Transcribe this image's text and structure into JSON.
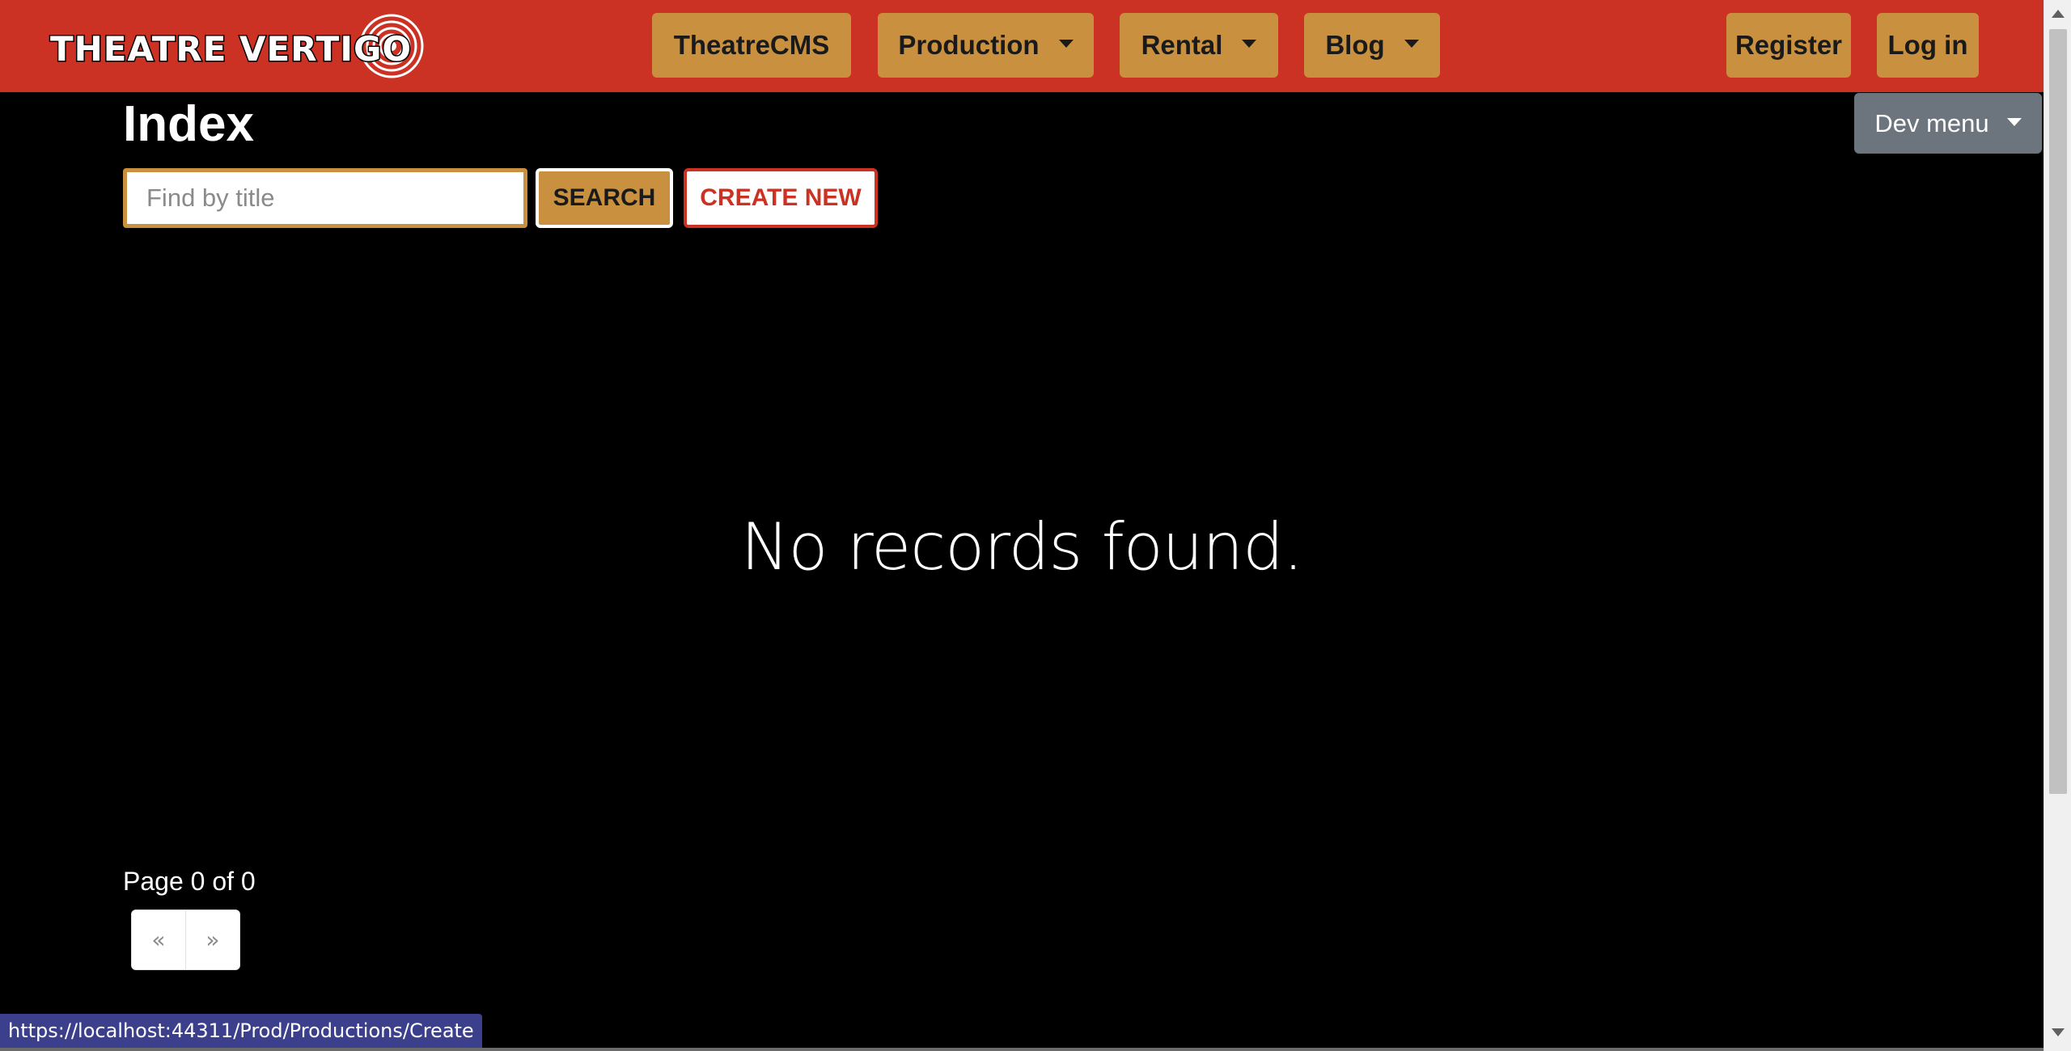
{
  "navbar": {
    "logo_text": "THEATRE VERTIGO",
    "items": [
      {
        "label": "TheatreCMS",
        "has_dropdown": false
      },
      {
        "label": "Production",
        "has_dropdown": true
      },
      {
        "label": "Rental",
        "has_dropdown": true
      },
      {
        "label": "Blog",
        "has_dropdown": true
      }
    ],
    "auth": {
      "register_label": "Register",
      "login_label": "Log in"
    },
    "colors": {
      "bar": "#cc3224",
      "button": "#c9913f"
    }
  },
  "dev_menu": {
    "label": "Dev menu"
  },
  "main": {
    "title": "Index",
    "search": {
      "placeholder": "Find by title",
      "value": "",
      "button_label": "SEARCH"
    },
    "create_label": "CREATE NEW",
    "empty_message": "No records found.",
    "pagination": {
      "summary": "Page 0 of 0",
      "prev_label": "«",
      "next_label": "»"
    }
  },
  "status_bar": {
    "url": "https://localhost:44311/Prod/Productions/Create"
  }
}
